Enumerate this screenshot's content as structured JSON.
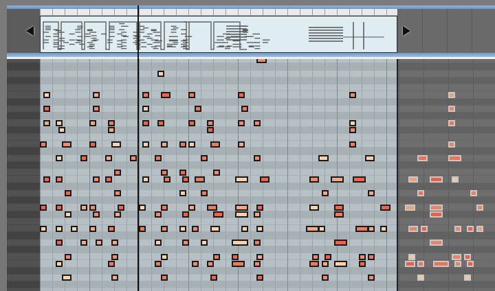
{
  "editor": {
    "view": "piano-roll",
    "playhead_beat": 7.9,
    "loop_end_16th": 116,
    "sixteenths_per_beat": 4,
    "beats_per_bar": 4,
    "visible_rows": 33
  },
  "colors": {
    "accent_blue": "#7aa3cf",
    "note_palette": [
      "#f08a6a",
      "#f4a886",
      "#f36246",
      "#fbd2ae",
      "#f0795a"
    ],
    "note_border": "#1a1a1a",
    "overview_bg": "#dfecf1"
  },
  "icons": {
    "scroll_left": "triangle-left-icon",
    "scroll_right": "triangle-right-icon"
  },
  "notes": [
    [
      0,
      70,
      3
    ],
    [
      2,
      38,
      2
    ],
    [
      5,
      1,
      2
    ],
    [
      5,
      17,
      2
    ],
    [
      5,
      33,
      2
    ],
    [
      5,
      39,
      3
    ],
    [
      5,
      48,
      2
    ],
    [
      5,
      64,
      2
    ],
    [
      5,
      100,
      2
    ],
    [
      5,
      132,
      2
    ],
    [
      7,
      1,
      2
    ],
    [
      7,
      17,
      2
    ],
    [
      7,
      33,
      2
    ],
    [
      7,
      50,
      2
    ],
    [
      7,
      65,
      2
    ],
    [
      7,
      132,
      2
    ],
    [
      9,
      1,
      2
    ],
    [
      9,
      5,
      2
    ],
    [
      9,
      16,
      2
    ],
    [
      9,
      22,
      2
    ],
    [
      9,
      33,
      2
    ],
    [
      9,
      38,
      2
    ],
    [
      9,
      48,
      2
    ],
    [
      9,
      54,
      2
    ],
    [
      9,
      64,
      2
    ],
    [
      9,
      69,
      2
    ],
    [
      9,
      100,
      2
    ],
    [
      9,
      132,
      2
    ],
    [
      10,
      6,
      2
    ],
    [
      10,
      22,
      2
    ],
    [
      10,
      54,
      2
    ],
    [
      10,
      100,
      2
    ],
    [
      12,
      0,
      2
    ],
    [
      12,
      7,
      3
    ],
    [
      12,
      16,
      2
    ],
    [
      12,
      23,
      3
    ],
    [
      12,
      33,
      2
    ],
    [
      12,
      39,
      2
    ],
    [
      12,
      45,
      2
    ],
    [
      12,
      48,
      2
    ],
    [
      12,
      55,
      3
    ],
    [
      12,
      64,
      2
    ],
    [
      12,
      100,
      2
    ],
    [
      12,
      132,
      2
    ],
    [
      14,
      5,
      2
    ],
    [
      14,
      13,
      2
    ],
    [
      14,
      21,
      2
    ],
    [
      14,
      29,
      2
    ],
    [
      14,
      37,
      2
    ],
    [
      14,
      52,
      2
    ],
    [
      14,
      69,
      2
    ],
    [
      14,
      90,
      3
    ],
    [
      14,
      105,
      3
    ],
    [
      14,
      122,
      3
    ],
    [
      14,
      132,
      4
    ],
    [
      16,
      24,
      2
    ],
    [
      16,
      39,
      2
    ],
    [
      16,
      45,
      2
    ],
    [
      16,
      56,
      2
    ],
    [
      17,
      1,
      2
    ],
    [
      17,
      5,
      2
    ],
    [
      17,
      17,
      2
    ],
    [
      17,
      21,
      2
    ],
    [
      17,
      33,
      2
    ],
    [
      17,
      40,
      2
    ],
    [
      17,
      46,
      2
    ],
    [
      17,
      50,
      3
    ],
    [
      17,
      63,
      4
    ],
    [
      17,
      71,
      3
    ],
    [
      17,
      87,
      3
    ],
    [
      17,
      94,
      4
    ],
    [
      17,
      101,
      4
    ],
    [
      17,
      119,
      3
    ],
    [
      17,
      126,
      4
    ],
    [
      17,
      133,
      2
    ],
    [
      19,
      8,
      2
    ],
    [
      19,
      24,
      2
    ],
    [
      19,
      45,
      2
    ],
    [
      19,
      52,
      2
    ],
    [
      19,
      91,
      2
    ],
    [
      19,
      106,
      2
    ],
    [
      19,
      122,
      2
    ],
    [
      19,
      139,
      2
    ],
    [
      21,
      0,
      2
    ],
    [
      21,
      5,
      2
    ],
    [
      21,
      13,
      2
    ],
    [
      21,
      16,
      2
    ],
    [
      21,
      25,
      2
    ],
    [
      21,
      32,
      2
    ],
    [
      21,
      39,
      2
    ],
    [
      21,
      48,
      2
    ],
    [
      21,
      54,
      3
    ],
    [
      21,
      63,
      4
    ],
    [
      21,
      70,
      2
    ],
    [
      21,
      87,
      3
    ],
    [
      21,
      95,
      3
    ],
    [
      21,
      110,
      3
    ],
    [
      21,
      118,
      3
    ],
    [
      21,
      126,
      4
    ],
    [
      21,
      141,
      2
    ],
    [
      22,
      8,
      2
    ],
    [
      22,
      17,
      2
    ],
    [
      22,
      24,
      2
    ],
    [
      22,
      37,
      2
    ],
    [
      22,
      46,
      2
    ],
    [
      22,
      56,
      3
    ],
    [
      22,
      63,
      4
    ],
    [
      22,
      69,
      2
    ],
    [
      22,
      95,
      3
    ],
    [
      22,
      126,
      4
    ],
    [
      24,
      0,
      2
    ],
    [
      24,
      5,
      2
    ],
    [
      24,
      10,
      2
    ],
    [
      24,
      16,
      2
    ],
    [
      24,
      22,
      2
    ],
    [
      24,
      32,
      2
    ],
    [
      24,
      39,
      2
    ],
    [
      24,
      45,
      2
    ],
    [
      24,
      49,
      2
    ],
    [
      24,
      55,
      3
    ],
    [
      24,
      65,
      2
    ],
    [
      24,
      70,
      2
    ],
    [
      24,
      86,
      4
    ],
    [
      24,
      90,
      2
    ],
    [
      24,
      102,
      4
    ],
    [
      24,
      106,
      2
    ],
    [
      24,
      110,
      2
    ],
    [
      24,
      119,
      3
    ],
    [
      24,
      123,
      2
    ],
    [
      24,
      134,
      2
    ],
    [
      24,
      138,
      2
    ],
    [
      24,
      141,
      2
    ],
    [
      26,
      5,
      2
    ],
    [
      26,
      13,
      2
    ],
    [
      26,
      18,
      2
    ],
    [
      26,
      23,
      2
    ],
    [
      26,
      37,
      2
    ],
    [
      26,
      46,
      2
    ],
    [
      26,
      52,
      2
    ],
    [
      26,
      62,
      5
    ],
    [
      26,
      69,
      2
    ],
    [
      26,
      95,
      4
    ],
    [
      26,
      126,
      4
    ],
    [
      28,
      8,
      2
    ],
    [
      28,
      23,
      2
    ],
    [
      28,
      39,
      2
    ],
    [
      28,
      56,
      2
    ],
    [
      28,
      62,
      2
    ],
    [
      28,
      70,
      2
    ],
    [
      28,
      88,
      2
    ],
    [
      28,
      92,
      2
    ],
    [
      28,
      103,
      2
    ],
    [
      28,
      106,
      2
    ],
    [
      28,
      119,
      2
    ],
    [
      28,
      133,
      3
    ],
    [
      28,
      137,
      2
    ],
    [
      29,
      5,
      2
    ],
    [
      29,
      22,
      2
    ],
    [
      29,
      37,
      2
    ],
    [
      29,
      49,
      2
    ],
    [
      29,
      54,
      2
    ],
    [
      29,
      62,
      4
    ],
    [
      29,
      69,
      2
    ],
    [
      29,
      87,
      3
    ],
    [
      29,
      91,
      2
    ],
    [
      29,
      95,
      4
    ],
    [
      29,
      103,
      2
    ],
    [
      29,
      118,
      3
    ],
    [
      29,
      122,
      2
    ],
    [
      29,
      127,
      5
    ],
    [
      29,
      134,
      2
    ],
    [
      29,
      138,
      2
    ],
    [
      31,
      7,
      3
    ],
    [
      31,
      23,
      2
    ],
    [
      31,
      39,
      2
    ],
    [
      31,
      55,
      2
    ],
    [
      31,
      70,
      2
    ],
    [
      31,
      91,
      2
    ],
    [
      31,
      106,
      2
    ],
    [
      31,
      122,
      2
    ],
    [
      31,
      137,
      2
    ]
  ]
}
